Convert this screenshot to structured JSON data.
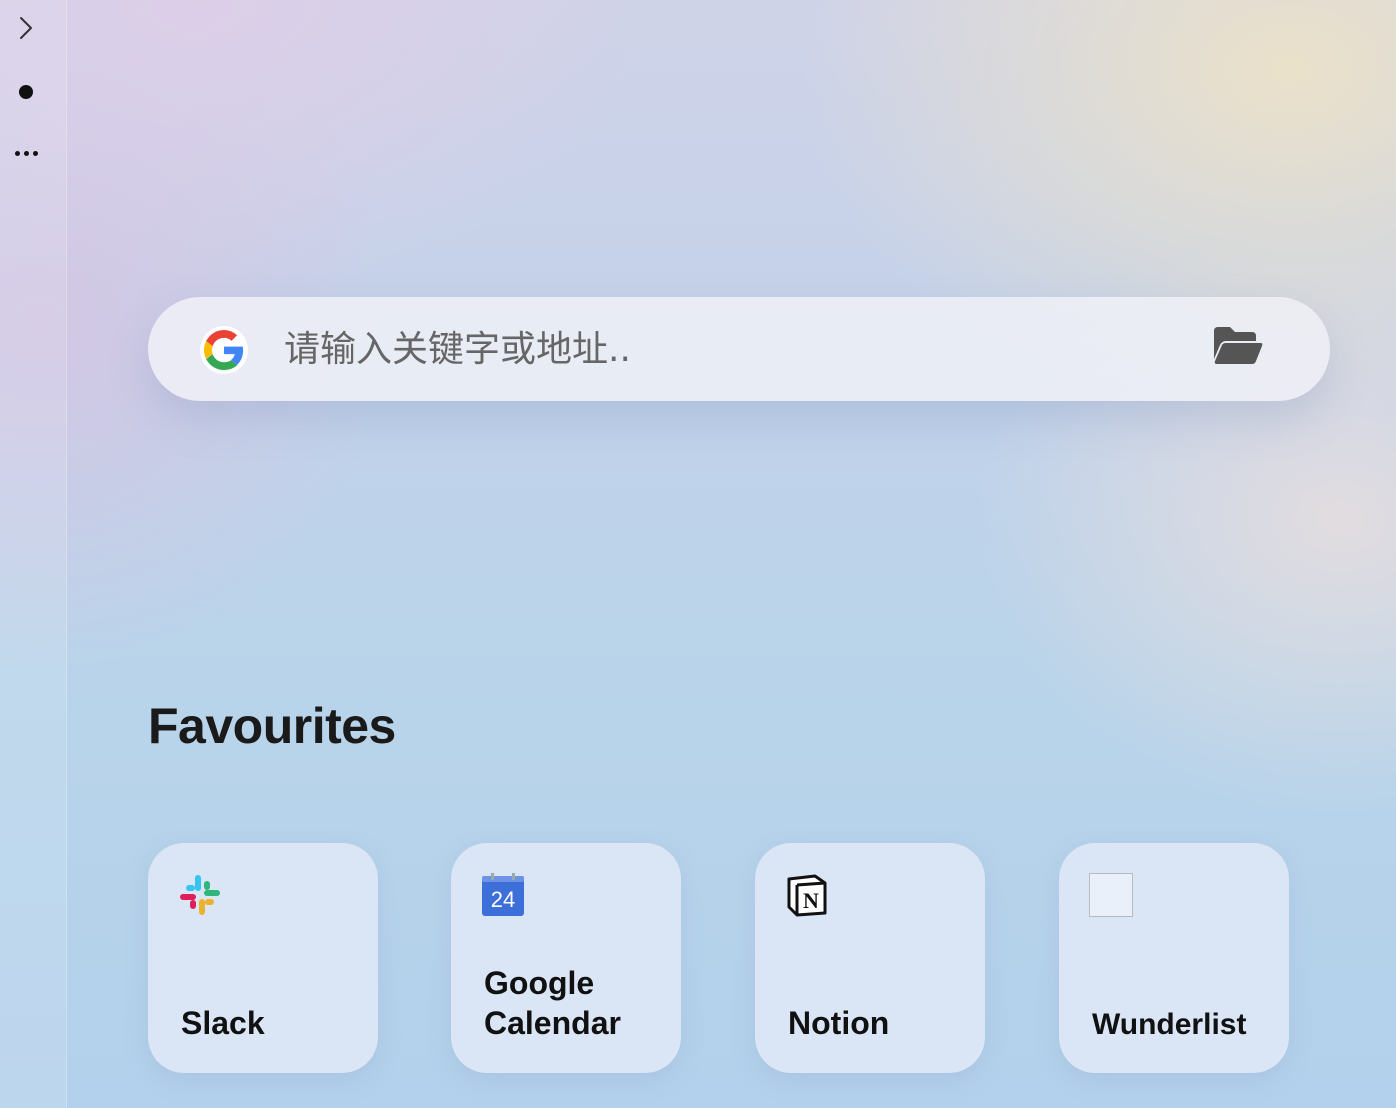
{
  "sidebar": {
    "items": [
      {
        "icon": "chevron-right-icon"
      },
      {
        "icon": "dot-icon"
      },
      {
        "icon": "more-icon"
      }
    ]
  },
  "search": {
    "placeholder": "请输入关键字或地址..",
    "engine_icon": "google-icon",
    "action_icon": "folder-open-icon"
  },
  "favourites": {
    "title": "Favourites",
    "items": [
      {
        "label": "Slack",
        "icon": "slack-icon"
      },
      {
        "label": "Google\nCalendar",
        "icon": "google-calendar-icon",
        "icon_text": "24"
      },
      {
        "label": "Notion",
        "icon": "notion-icon",
        "icon_text": "N"
      },
      {
        "label": "Wunderlist",
        "icon": "placeholder-icon"
      }
    ]
  },
  "colors": {
    "google_blue": "#4285F4",
    "google_red": "#EA4335",
    "google_yellow": "#FBBC05",
    "google_green": "#34A853",
    "calendar_blue": "#3C6FD8"
  }
}
